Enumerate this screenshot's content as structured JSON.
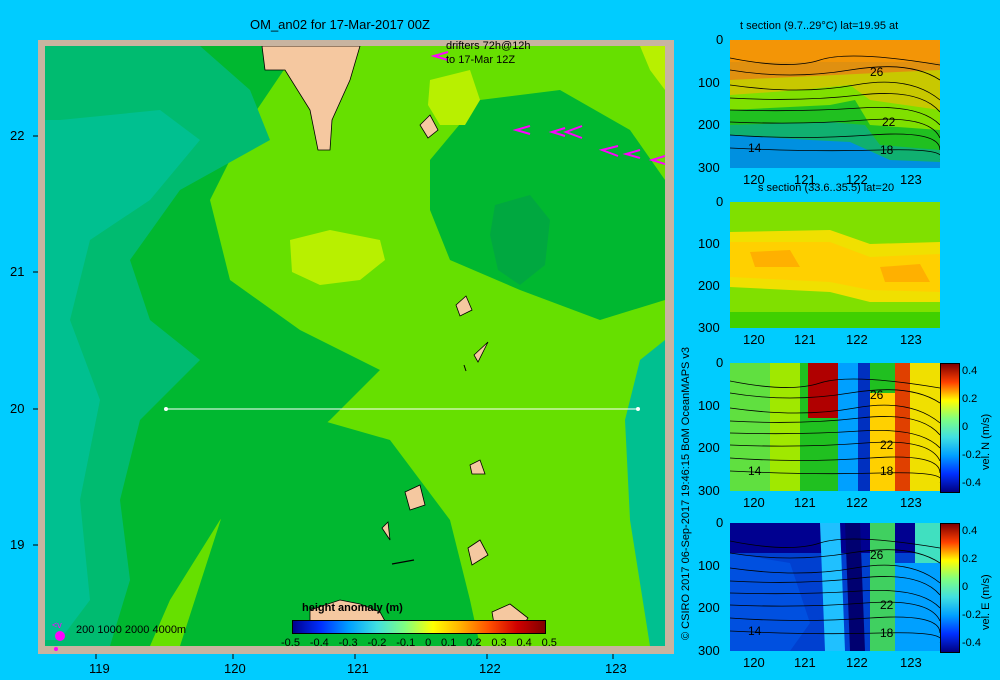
{
  "map": {
    "title": "OM_an02 for 17-Mar-2017 00Z",
    "drifters_line1": "drifters 72h@12h",
    "drifters_line2": "to 17-Mar 12Z",
    "lon_ticks": [
      "119",
      "120",
      "121",
      "122",
      "123"
    ],
    "lat_ticks": [
      "22",
      "21",
      "20",
      "19"
    ],
    "depth_legend": "200  1000  2000  4000m",
    "colorbar_title": "height anomaly (m)",
    "colorbar_ticks": [
      "-0.5",
      "-0.4",
      "-0.3",
      "-0.2",
      "-0.1",
      "0",
      "0.1",
      "0.2",
      "0.3",
      "0.4",
      "0.5"
    ],
    "section_line": {
      "lon_start": 119.5,
      "lon_end": 123.2,
      "lat": 20
    }
  },
  "credit": "© CSIRO 2017   06-Sep-2017 19:46:15 BoM OceanMAPS v3",
  "panels": [
    {
      "title": "t section (9.7..29°C) lat=19.95 at",
      "contour_labels": [
        "26",
        "22",
        "18",
        "14"
      ],
      "colorbar": false
    },
    {
      "title": "s section (33.6..35.5) lat=20",
      "contour_labels": [],
      "colorbar": false
    },
    {
      "title": "",
      "contour_labels": [
        "26",
        "22",
        "18",
        "14"
      ],
      "colorbar": true,
      "colorbar_label": "vel. N  (m/s)"
    },
    {
      "title": "",
      "contour_labels": [
        "26",
        "22",
        "18",
        "14"
      ],
      "colorbar": true,
      "colorbar_label": "vel. E  (m/s)"
    }
  ],
  "panel_x_ticks": [
    "120",
    "121",
    "122",
    "123"
  ],
  "panel_y_ticks": [
    "0",
    "100",
    "200",
    "300"
  ],
  "vel_ticks": [
    "0.4",
    "0.2",
    "0",
    "-0.2",
    "-0.4"
  ],
  "chart_data": [
    {
      "type": "heatmap",
      "title": "OM_an02 for 17-Mar-2017 00Z",
      "variable": "height anomaly (m)",
      "x_range": [
        118.6,
        123.5
      ],
      "y_range": [
        18.3,
        22.7
      ],
      "color_range": [
        -0.5,
        0.5
      ],
      "section_lat": 20,
      "section_lon_range": [
        119.5,
        123.2
      ]
    },
    {
      "type": "heatmap",
      "title": "t section (9.7..29°C) lat=19.95 at",
      "x_range": [
        119.5,
        123.2
      ],
      "y_range": [
        300,
        0
      ],
      "contours": [
        26,
        22,
        18,
        14
      ]
    },
    {
      "type": "heatmap",
      "title": "s section (33.6..35.5) lat=20",
      "x_range": [
        119.5,
        123.2
      ],
      "y_range": [
        300,
        0
      ]
    },
    {
      "type": "heatmap",
      "variable": "vel. N (m/s)",
      "x_range": [
        119.5,
        123.2
      ],
      "y_range": [
        300,
        0
      ],
      "color_range": [
        -0.4,
        0.4
      ],
      "contours": [
        26,
        22,
        18,
        14
      ]
    },
    {
      "type": "heatmap",
      "variable": "vel. E (m/s)",
      "x_range": [
        119.5,
        123.2
      ],
      "y_range": [
        300,
        0
      ],
      "color_range": [
        -0.4,
        0.4
      ],
      "contours": [
        26,
        22,
        18,
        14
      ]
    }
  ],
  "colors": {
    "background": "#00ccff",
    "frame": "#c8b4a0",
    "land": "#f5c8a0",
    "ssh_low": "#00c080",
    "ssh_mid": "#00b830",
    "ssh_high": "#66e000",
    "ssh_peak": "#b8f000",
    "drifter": "#ff00ff"
  }
}
